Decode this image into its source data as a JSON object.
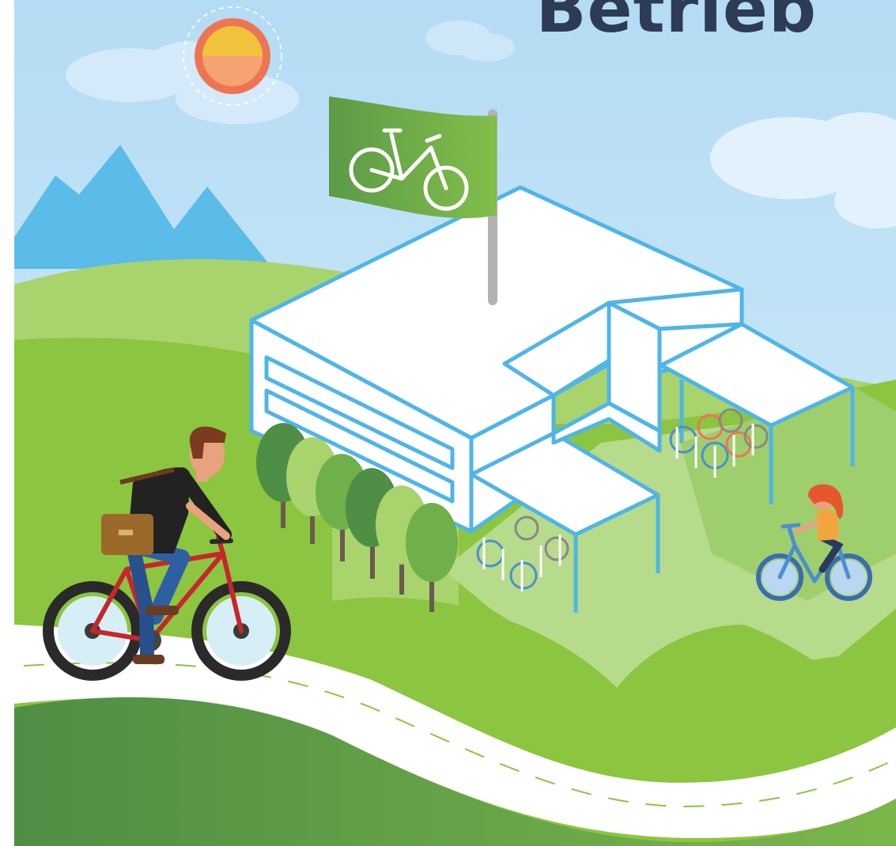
{
  "header": {
    "title": "Betrieb"
  },
  "colors": {
    "sky": "#bfe1f6",
    "mountain": "#5bbbe9",
    "hill_light": "#8cc53f",
    "hill_dark": "#5e9e4c",
    "building_outline": "#4fb5e8",
    "flag": "#6aaa4d",
    "sun": "#f0c33d",
    "sun_ring": "#ee7553",
    "headline": "#2e3b55",
    "bike_red": "#c6262c",
    "bike_blue": "#4a8fd1"
  },
  "icons": [
    "sun-icon",
    "bicycle-icon",
    "cloud-icon"
  ]
}
